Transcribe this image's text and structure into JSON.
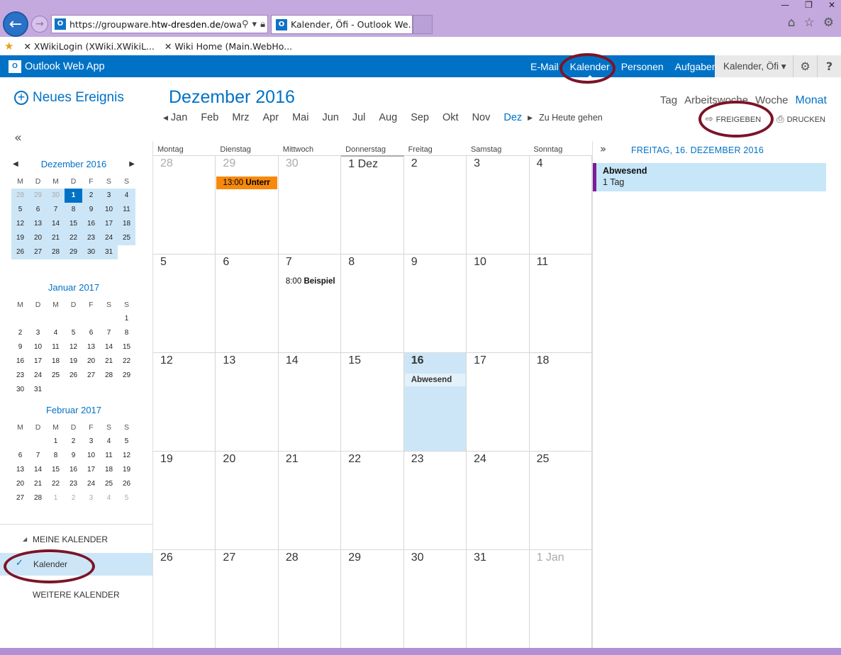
{
  "browser": {
    "url_prefix": "https://groupware.",
    "url_host": "htw-dresden.de",
    "url_suffix": "/owa",
    "tab_title": "Kalender, Öfi - Outlook We...",
    "tab_close": "×",
    "window_controls": [
      "—",
      "❐",
      "✕"
    ],
    "toolbar_icons": [
      "home-icon",
      "star-icon",
      "gear-icon"
    ],
    "favorites": [
      {
        "icon": "xwiki-icon",
        "label": "XWikiLogin (XWiki.XWikiL..."
      },
      {
        "icon": "xwiki-icon",
        "label": "Wiki Home (Main.WebHo..."
      }
    ]
  },
  "owa": {
    "app_name": "Outlook Web App",
    "nav": [
      "E-Mail",
      "Kalender",
      "Personen",
      "Aufgaben"
    ],
    "active_nav": "Kalender",
    "user": "Kalender, Öfi ▾",
    "help": "?"
  },
  "sidebar": {
    "new_event": "Neues Ereignis",
    "collapse": "«",
    "my_calendars": "MEINE KALENDER",
    "calendar_item": "Kalender",
    "more_calendars": "WEITERE KALENDER"
  },
  "mini_calendars": [
    {
      "title": "Dezember 2016",
      "weekdays": [
        "M",
        "D",
        "M",
        "D",
        "F",
        "S",
        "S"
      ],
      "days": [
        "28",
        "29",
        "30",
        "1",
        "2",
        "3",
        "4",
        "5",
        "6",
        "7",
        "8",
        "9",
        "10",
        "11",
        "12",
        "13",
        "14",
        "15",
        "16",
        "17",
        "18",
        "19",
        "20",
        "21",
        "22",
        "23",
        "24",
        "25",
        "26",
        "27",
        "28",
        "29",
        "30",
        "31"
      ],
      "dim_leading": 3,
      "today_index": 3,
      "highlight_count": 34
    },
    {
      "title": "Januar 2017",
      "weekdays": [
        "M",
        "D",
        "M",
        "D",
        "F",
        "S",
        "S"
      ],
      "days": [
        "",
        "",
        "",
        "",
        "",
        "",
        "1",
        "2",
        "3",
        "4",
        "5",
        "6",
        "7",
        "8",
        "9",
        "10",
        "11",
        "12",
        "13",
        "14",
        "15",
        "16",
        "17",
        "18",
        "19",
        "20",
        "21",
        "22",
        "23",
        "24",
        "25",
        "26",
        "27",
        "28",
        "29",
        "30",
        "31"
      ],
      "dim_leading": 0,
      "today_index": -1,
      "highlight_count": 0
    },
    {
      "title": "Februar 2017",
      "weekdays": [
        "M",
        "D",
        "M",
        "D",
        "F",
        "S",
        "S"
      ],
      "days": [
        "",
        "",
        "1",
        "2",
        "3",
        "4",
        "5",
        "6",
        "7",
        "8",
        "9",
        "10",
        "11",
        "12",
        "13",
        "14",
        "15",
        "16",
        "17",
        "18",
        "19",
        "20",
        "21",
        "22",
        "23",
        "24",
        "25",
        "26",
        "27",
        "28",
        "1",
        "2",
        "3",
        "4",
        "5"
      ],
      "dim_leading": 0,
      "dim_trailing": 5,
      "today_index": -1,
      "highlight_count": 0
    }
  ],
  "calendar": {
    "month_title": "Dezember 2016",
    "months": [
      "Jan",
      "Feb",
      "Mrz",
      "Apr",
      "Mai",
      "Jun",
      "Jul",
      "Aug",
      "Sep",
      "Okt",
      "Nov"
    ],
    "current_month": "Dez",
    "go_today": "Zu Heute gehen",
    "views": [
      "Tag",
      "Arbeitswoche",
      "Woche",
      "Monat"
    ],
    "active_view": "Monat",
    "share": "FREIGEBEN",
    "print": "DRUCKEN",
    "weekdays": [
      "Montag",
      "Dienstag",
      "Mittwoch",
      "Donnerstag",
      "Freitag",
      "Samstag",
      "Sonntag"
    ],
    "cells": [
      "28",
      "29",
      "30",
      "1 Dez",
      "2",
      "3",
      "4",
      "5",
      "6",
      "7",
      "8",
      "9",
      "10",
      "11",
      "12",
      "13",
      "14",
      "15",
      "16",
      "17",
      "18",
      "19",
      "20",
      "21",
      "22",
      "23",
      "24",
      "25",
      "26",
      "27",
      "28",
      "29",
      "30",
      "31",
      "1 Jan"
    ],
    "dim_cells": [
      0,
      1,
      2,
      34
    ],
    "today_cell": 18,
    "first_day_cell": 3,
    "events": [
      {
        "cell": 1,
        "time": "13:00",
        "title": "Unterr",
        "style": "orange"
      },
      {
        "cell": 9,
        "time": "8:00",
        "title": "Beispiel",
        "style": "plain"
      },
      {
        "cell": 18,
        "time": "",
        "title": "Abwesend",
        "style": "abw"
      }
    ]
  },
  "detail": {
    "expand": "»",
    "date_title": "FREITAG, 16. DEZEMBER 2016",
    "event_title": "Abwesend",
    "event_sub": "1 Tag"
  },
  "colors": {
    "accent": "#0072c6",
    "chrome": "#c4a9df",
    "today": "#cde6f7",
    "event_orange": "#f7890c",
    "annotation": "#7b1428"
  }
}
